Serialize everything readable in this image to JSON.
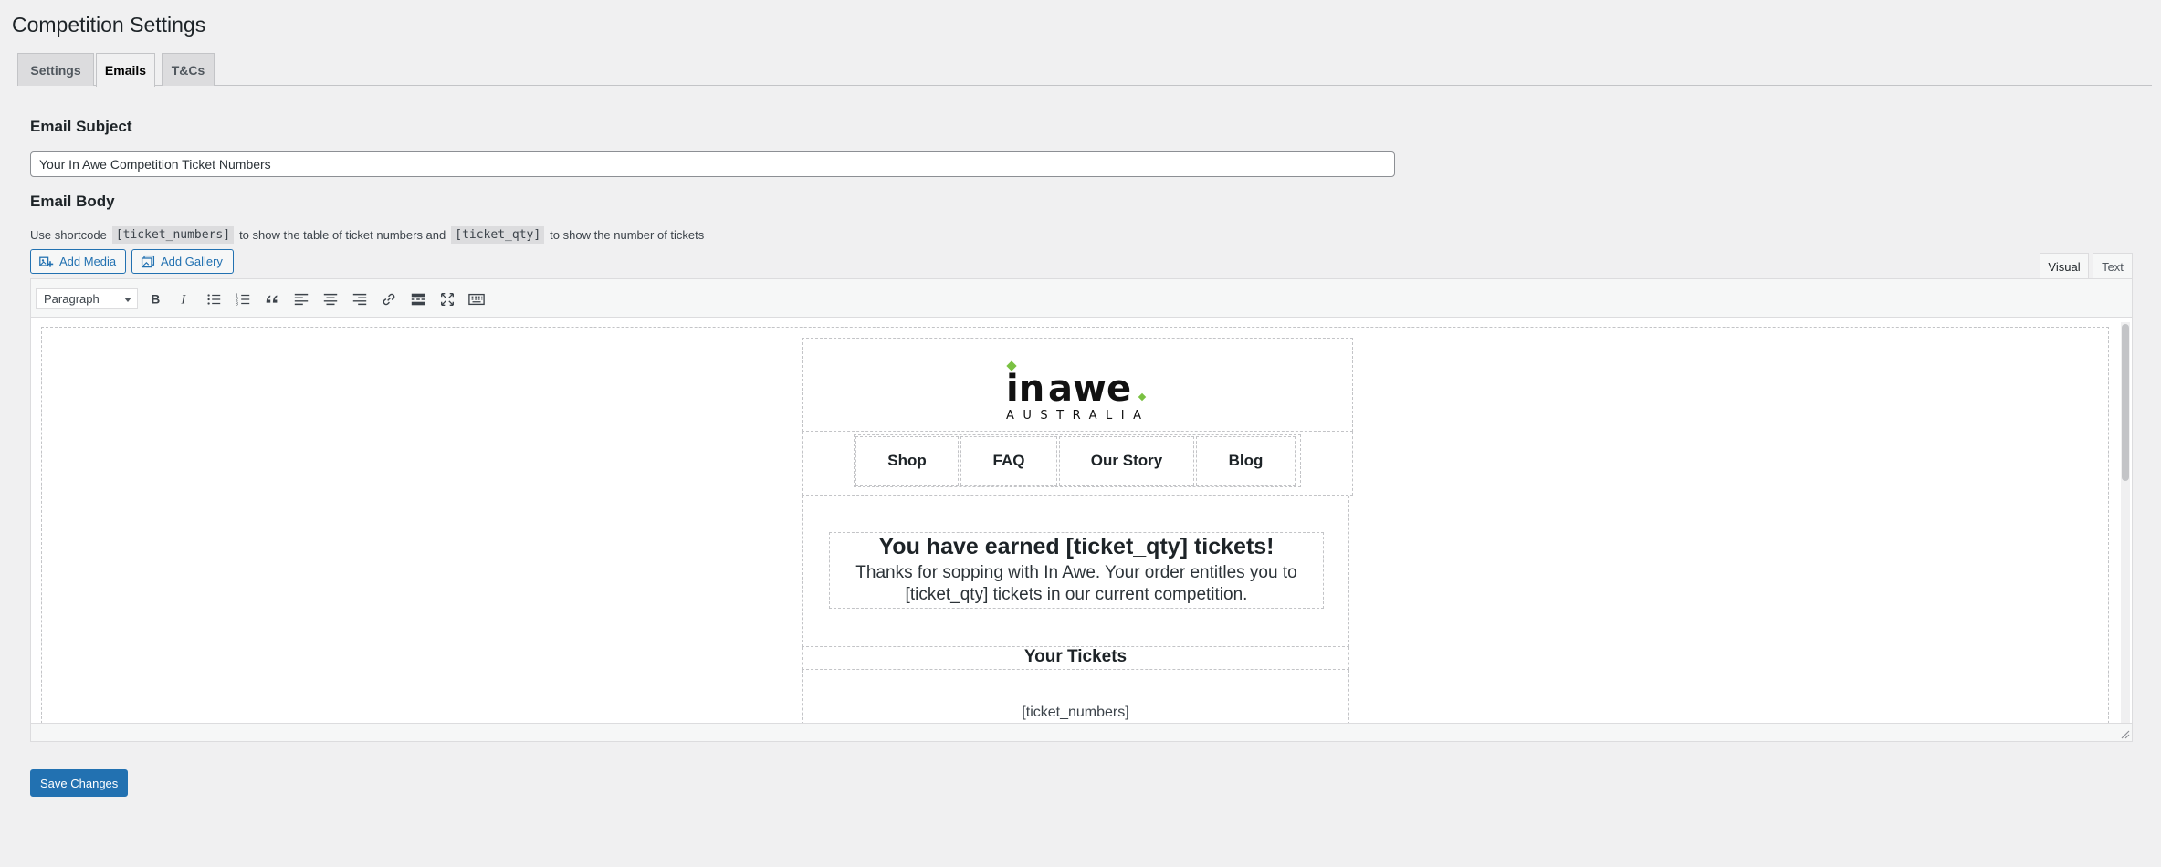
{
  "page": {
    "title": "Competition Settings"
  },
  "tabs": [
    {
      "label": "Settings",
      "active": false
    },
    {
      "label": "Emails",
      "active": true
    },
    {
      "label": "T&Cs",
      "active": false
    }
  ],
  "email_subject": {
    "heading": "Email Subject",
    "value": "Your In Awe Competition Ticket Numbers"
  },
  "email_body": {
    "heading": "Email Body",
    "help": {
      "prefix": "Use shortcode",
      "code1": "[ticket_numbers]",
      "middle": "to show the table of ticket numbers and",
      "code2": "[ticket_qty]",
      "suffix": "to show the number of tickets"
    },
    "buttons": {
      "add_media": "Add Media",
      "add_gallery": "Add Gallery"
    },
    "modes": {
      "visual": "Visual",
      "text": "Text",
      "active": "Visual"
    },
    "toolbar": {
      "format": "Paragraph",
      "buttons": [
        "bold",
        "italic",
        "bulleted-list",
        "numbered-list",
        "blockquote",
        "align-left",
        "align-center",
        "align-right",
        "insert-link",
        "read-more",
        "fullscreen",
        "toolbar-toggle"
      ]
    },
    "content": {
      "logo": {
        "word1": "in",
        "word2": "awe",
        "sub": "AUSTRALIA"
      },
      "nav": [
        "Shop",
        "FAQ",
        "Our Story",
        "Blog"
      ],
      "hero_title": "You have earned [ticket_qty] tickets!",
      "hero_text": "Thanks for sopping with In Awe. Your order entitles you to [ticket_qty] tickets in our current competition.",
      "tickets_heading": "Your Tickets",
      "tickets_shortcode": "[ticket_numbers]"
    }
  },
  "actions": {
    "save": "Save Changes"
  },
  "colors": {
    "accent": "#2271b1",
    "logo_green": "#7ac142",
    "background": "#f0f0f1"
  }
}
